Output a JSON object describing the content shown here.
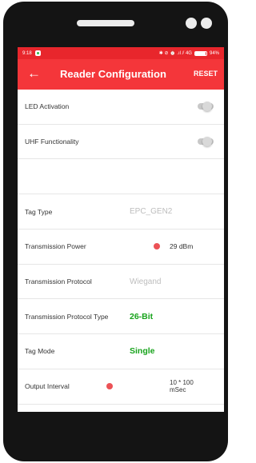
{
  "status_bar": {
    "time": "9:18",
    "icons": "✱ ⊘ ⏰ .ıl ⫽ 4G",
    "battery_label": "94%",
    "battery_level": 0.94
  },
  "app_bar": {
    "title": "Reader Configuration",
    "reset_label": "RESET",
    "back_icon": "←"
  },
  "settings": {
    "led_activation": {
      "label": "LED Activation",
      "enabled": false
    },
    "uhf_functionality": {
      "label": "UHF Functionality",
      "enabled": false
    },
    "tag_type": {
      "label": "Tag Type",
      "value": "EPC_GEN2"
    },
    "transmission_power": {
      "label": "Transmission Power",
      "value": "29 dBm"
    },
    "transmission_protocol": {
      "label": "Transmission Protocol",
      "value": "Wiegand"
    },
    "transmission_protocol_type": {
      "label": "Transmission Protocol Type",
      "value": "26-Bit"
    },
    "tag_mode": {
      "label": "Tag Mode",
      "value": "Single"
    },
    "output_interval": {
      "label": "Output Interval",
      "value_line1": "10 * 100",
      "value_line2": "mSec"
    }
  },
  "colors": {
    "accent": "#f4363a",
    "status_bar": "#e8262c",
    "value_green": "#17a31b",
    "slider_dot": "#ec5256"
  }
}
